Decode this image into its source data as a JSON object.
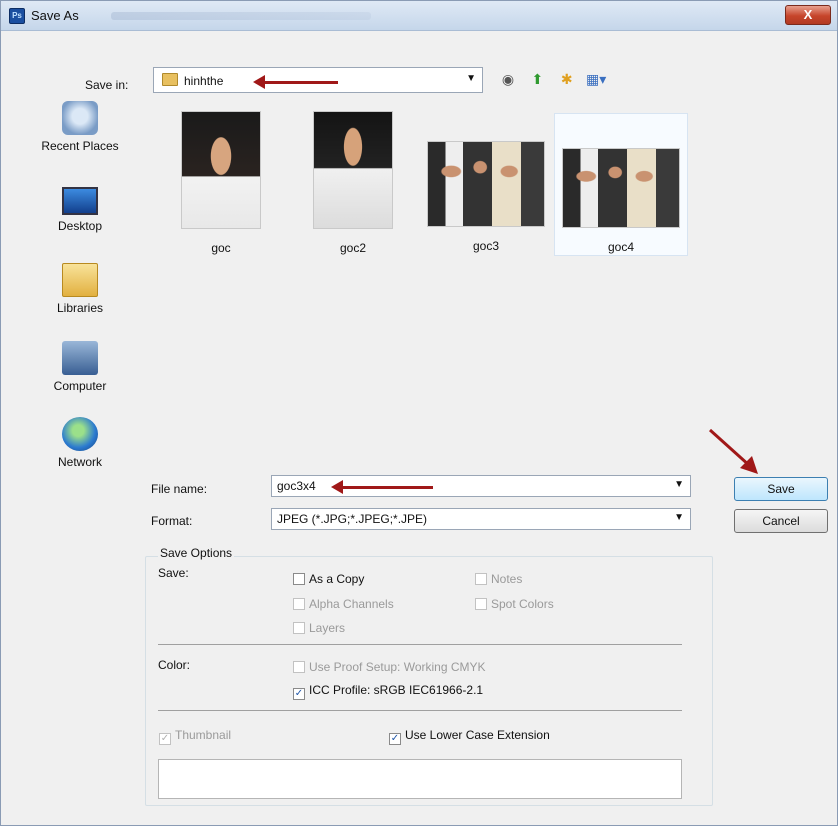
{
  "window": {
    "app_icon_label": "Ps",
    "title": "Save As",
    "close_label": "X"
  },
  "save_in": {
    "label": "Save in:",
    "value": "hinhthe"
  },
  "places": [
    {
      "label": "Recent Places",
      "icon": "recent-places-icon"
    },
    {
      "label": "Desktop",
      "icon": "desktop-icon"
    },
    {
      "label": "Libraries",
      "icon": "libraries-icon"
    },
    {
      "label": "Computer",
      "icon": "computer-icon"
    },
    {
      "label": "Network",
      "icon": "network-icon"
    }
  ],
  "files": [
    {
      "name": "goc"
    },
    {
      "name": "goc2"
    },
    {
      "name": "goc3"
    },
    {
      "name": "goc4"
    }
  ],
  "file_name": {
    "label": "File name:",
    "value": "goc3x4"
  },
  "format": {
    "label": "Format:",
    "value": "JPEG (*.JPG;*.JPEG;*.JPE)"
  },
  "buttons": {
    "save": "Save",
    "cancel": "Cancel"
  },
  "save_options": {
    "title": "Save Options",
    "save_label": "Save:",
    "as_a_copy": "As a Copy",
    "notes": "Notes",
    "alpha_channels": "Alpha Channels",
    "spot_colors": "Spot Colors",
    "layers": "Layers",
    "color_label": "Color:",
    "use_proof_setup": "Use Proof Setup:  Working CMYK",
    "icc_profile": "ICC Profile:  sRGB IEC61966-2.1",
    "thumbnail": "Thumbnail",
    "use_lower_case": "Use Lower Case Extension"
  },
  "checked_marks": {
    "icc_profile": "✓",
    "thumbnail": "✓",
    "use_lower_case": "✓"
  }
}
